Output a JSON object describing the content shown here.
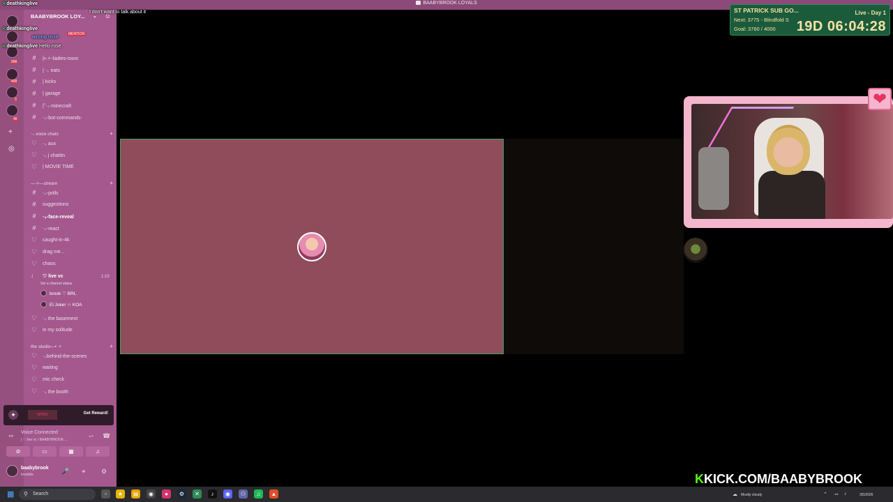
{
  "window": {
    "title": "BAABYBROOK LOYALS"
  },
  "chat_overlay": {
    "lines": [
      {
        "user": "deathkinglive",
        "msg": ""
      },
      {
        "user": "",
        "msg": "I don't want to talk about it"
      },
      {
        "user": "deathkinglive",
        "msg": ""
      },
      {
        "user": "wrong rose",
        "msg": ""
      },
      {
        "user": "deathkinglive",
        "msg": "Hello rose"
      }
    ],
    "badge_k": "K",
    "mention_badge": "MENTION"
  },
  "server": {
    "name": "BAABYBROOK LOY..."
  },
  "rail": {
    "badges": [
      "998",
      "499",
      "3",
      "46"
    ]
  },
  "channels_top": [
    {
      "sym": "#",
      "name": "|•˖✧-ladies-room"
    },
    {
      "sym": "#",
      "name": "| ‧₊ eats"
    },
    {
      "sym": "#",
      "name": "| kicks"
    },
    {
      "sym": "#",
      "name": "| garage"
    },
    {
      "sym": "#",
      "name": "|˚‧₊-minecraft"
    },
    {
      "sym": "#",
      "name": "‧₊-bot-commands‧"
    }
  ],
  "categories": {
    "voice": "‧₊ voice chats",
    "stream": "—✧—stream",
    "studio": "the studio—• ✧"
  },
  "voice_channels": [
    {
      "sym": "♡",
      "name": "‧₊ aux"
    },
    {
      "sym": "♡",
      "name": "‧₊ j chattin"
    },
    {
      "sym": "♡",
      "name": "| MOVIE TIME"
    }
  ],
  "stream_channels": [
    {
      "sym": "#",
      "name": "‧₊-polls",
      "bold": false
    },
    {
      "sym": "#",
      "name": "suggestions",
      "bold": false
    },
    {
      "sym": "#",
      "name": "‧₊-face-reveal",
      "bold": true
    },
    {
      "sym": "#",
      "name": "‧₊-react",
      "bold": false
    },
    {
      "sym": "♡",
      "name": "caught-in-4k",
      "bold": false
    },
    {
      "sym": "♡",
      "name": "drag me...",
      "bold": false
    },
    {
      "sym": "♡",
      "name": "chaos",
      "bold": false
    }
  ],
  "live_vc": {
    "name": "♡ live vc",
    "time": "1:10",
    "status": "Set a channel status",
    "users": [
      {
        "name": "brook ♡ BRL"
      },
      {
        "name": "El Joker ☆ KOA"
      }
    ]
  },
  "more_voice": [
    {
      "sym": "♡",
      "name": "‧₊ the basement"
    },
    {
      "sym": "♡",
      "name": "in my solitude"
    }
  ],
  "studio_channels": [
    {
      "sym": "♡",
      "name": "‧₊behind-the-scenes"
    },
    {
      "sym": "♡",
      "name": "waiting"
    },
    {
      "sym": "♡",
      "name": "mic check"
    },
    {
      "sym": "♡",
      "name": "‧₊ the booth"
    }
  ],
  "boost": {
    "promo": "NITRO",
    "cta": "Get Reward!"
  },
  "voice_panel": {
    "status": "Voice Connected",
    "channel": "| ♡ live vc / BAABYBROOK ..."
  },
  "user_panel": {
    "name": "baabybrook",
    "status": "Invisible"
  },
  "timer": {
    "title": "ST PATRICK SUB GO...",
    "live": "Live - Day 1",
    "next": "Next: 3775 - Blindfold S",
    "goal": "Goal: 3760 / 4000",
    "countdown": "19D 06:04:28"
  },
  "kick": {
    "k": "K",
    "text": "KICK.COM/BAABYBROOK"
  },
  "taskbar": {
    "search_placeholder": "Search",
    "weather": "Mostly cloudy",
    "date": "3/5/2026"
  },
  "colors": {
    "sidebar": "#a4588e",
    "rail": "#96507f",
    "stage_main": "#914c5c",
    "speaking_border": "#3fa266",
    "timer_bg": "#1b5b3b",
    "timer_text": "#f5e2a4",
    "kick_green": "#53fc18",
    "webcam_frame": "#f4b6cd"
  }
}
